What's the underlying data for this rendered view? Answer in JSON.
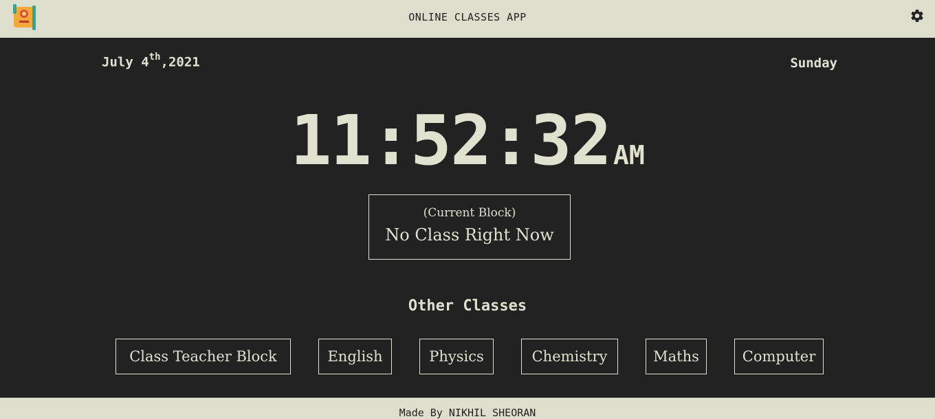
{
  "header": {
    "title": "ONLINE CLASSES APP",
    "logo_icon": "book-logo-icon",
    "settings_icon": "gear-icon"
  },
  "date": {
    "month_day": "July 4",
    "suffix": "th",
    "year": ",2021",
    "weekday": "Sunday"
  },
  "clock": {
    "time": "11:52:32",
    "meridiem": "AM"
  },
  "current_block": {
    "label": "(Current Block)",
    "value": "No Class Right Now"
  },
  "other_classes": {
    "title": "Other Classes",
    "items": [
      {
        "label": "Class Teacher Block"
      },
      {
        "label": "English"
      },
      {
        "label": "Physics"
      },
      {
        "label": "Chemistry"
      },
      {
        "label": "Maths"
      },
      {
        "label": "Computer"
      }
    ]
  },
  "footer": {
    "text": "Made By NIKHIL SHEORAN"
  },
  "colors": {
    "bar_background": "#dddfcc",
    "main_background": "#222222",
    "text_light": "#e0e1cf"
  }
}
